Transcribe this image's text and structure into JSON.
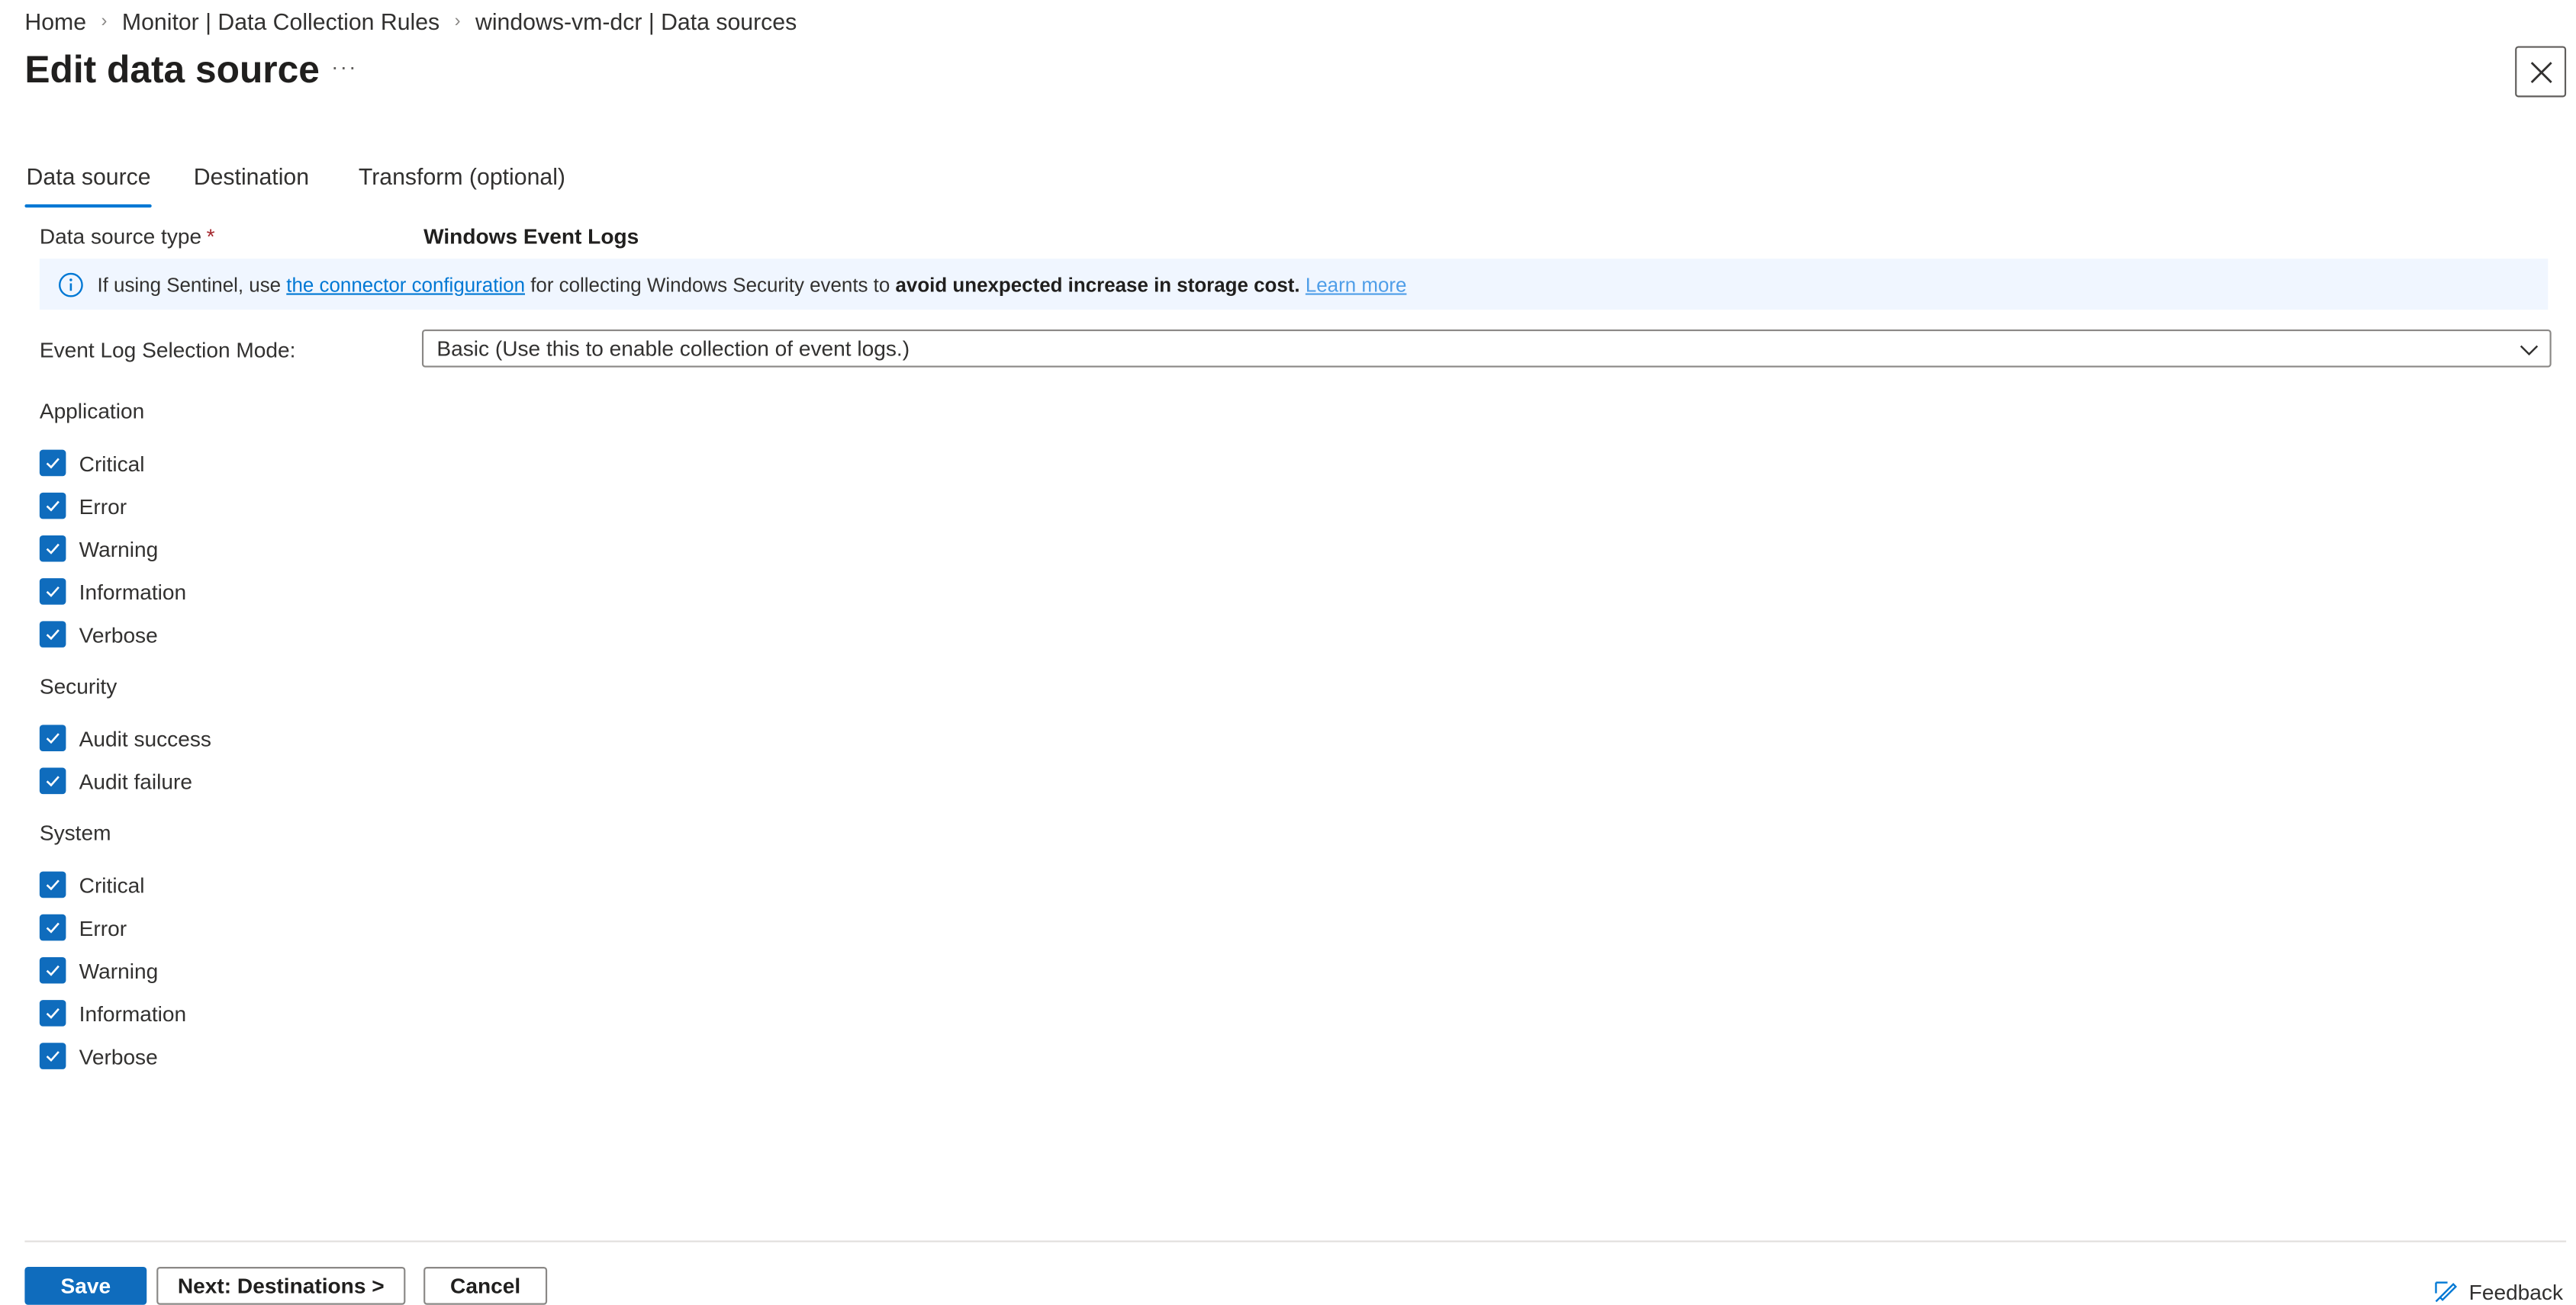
{
  "breadcrumb": {
    "items": [
      "Home",
      "Monitor | Data Collection Rules",
      "windows-vm-dcr | Data sources"
    ]
  },
  "page": {
    "title": "Edit data source",
    "more_label": "···"
  },
  "tabs": [
    {
      "label": "Data source",
      "active": true
    },
    {
      "label": "Destination",
      "active": false
    },
    {
      "label": "Transform (optional)",
      "active": false
    }
  ],
  "data_source_type": {
    "label": "Data source type",
    "required_mark": "*",
    "value": "Windows Event Logs"
  },
  "info_banner": {
    "prefix": "If using Sentinel, use",
    "link": "the connector configuration",
    "middle": "for collecting Windows Security events to",
    "bold": "avoid unexpected increase in storage cost.",
    "learn_more": "Learn more"
  },
  "mode": {
    "label": "Event Log Selection Mode:",
    "value": "Basic (Use this to enable collection of event logs.)"
  },
  "sections": {
    "application": {
      "title": "Application",
      "items": [
        "Critical",
        "Error",
        "Warning",
        "Information",
        "Verbose"
      ]
    },
    "security": {
      "title": "Security",
      "items": [
        "Audit success",
        "Audit failure"
      ]
    },
    "system": {
      "title": "System",
      "items": [
        "Critical",
        "Error",
        "Warning",
        "Information",
        "Verbose"
      ]
    }
  },
  "footer": {
    "save": "Save",
    "next": "Next: Destinations >",
    "cancel": "Cancel",
    "feedback": "Feedback"
  },
  "colors": {
    "accent": "#0078d4",
    "checkbox": "#0f6cbd",
    "banner_bg": "#f0f6ff",
    "required": "#a4262c"
  },
  "icons": [
    "chevron-right-icon",
    "more-icon",
    "close-icon",
    "info-icon",
    "chevron-down-icon",
    "checkmark-icon",
    "feedback-icon"
  ]
}
